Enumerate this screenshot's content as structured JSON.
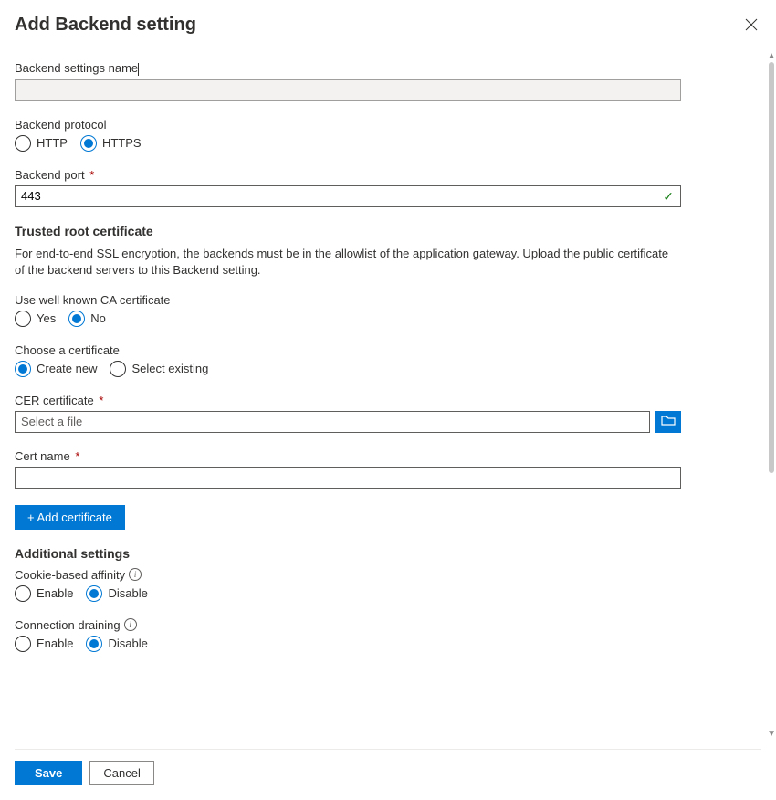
{
  "header": {
    "title": "Add Backend setting"
  },
  "fields": {
    "name_label": "Backend settings name",
    "protocol_label": "Backend protocol",
    "protocol_http": "HTTP",
    "protocol_https": "HTTPS",
    "port_label": "Backend port",
    "port_value": "443"
  },
  "trusted": {
    "heading": "Trusted root certificate",
    "desc": "For end-to-end SSL encryption, the backends must be in the allowlist of the application gateway. Upload the public certificate of the backend servers to this Backend setting.",
    "ca_label": "Use well known CA certificate",
    "ca_yes": "Yes",
    "ca_no": "No",
    "choose_label": "Choose a certificate",
    "choose_new": "Create new",
    "choose_existing": "Select existing",
    "cer_label": "CER certificate",
    "cer_placeholder": "Select a file",
    "certname_label": "Cert name",
    "add_btn": "+ Add certificate"
  },
  "additional": {
    "heading": "Additional settings",
    "cookie_label": "Cookie-based affinity",
    "drain_label": "Connection draining",
    "enable": "Enable",
    "disable": "Disable"
  },
  "footer": {
    "save": "Save",
    "cancel": "Cancel"
  },
  "required": "*"
}
